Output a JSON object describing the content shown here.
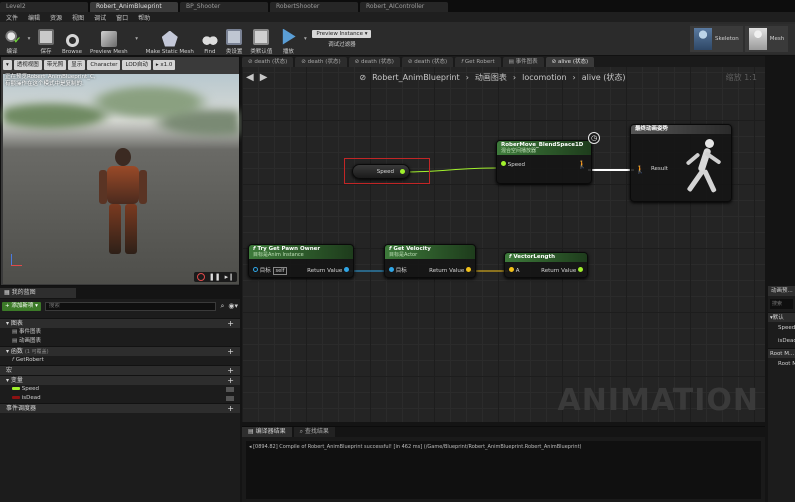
{
  "doc_tabs": [
    "Level2",
    "Robert_AnimBlueprint",
    "BP_Shooter",
    "RobertShooter",
    "Robert_AIController"
  ],
  "menu": [
    "文件",
    "编辑",
    "资源",
    "视图",
    "调试",
    "窗口",
    "帮助"
  ],
  "toolbar": {
    "compile": "编译",
    "save": "保存",
    "browse": "Browse",
    "preview_mesh": "Preview Mesh",
    "make_static_mesh": "Make Static Mesh",
    "find": "Find",
    "class_settings": "类设置",
    "class_defaults": "类默认值",
    "play": "播放",
    "preview_instance": "Preview Instance ▾",
    "debug_filter": "调试过滤器"
  },
  "asset_modes": {
    "skeleton": "Skeleton",
    "mesh": "Mesh"
  },
  "viewport": {
    "buttons": [
      "▾",
      "透视视图",
      "带光照",
      "显示",
      "Character",
      "LOD自动",
      "▸ x1.0"
    ],
    "info_line1": "正在预览Robert_AnimBlueprint_C,",
    "info_line2": "有额操作在这个模式中是复制的."
  },
  "my_blueprint": {
    "tab": "我的蓝图",
    "add_new": "+ 添加新项 ▾",
    "search_placeholder": "搜索",
    "sections": {
      "graphs": "图表",
      "event_graph": "事件图表",
      "anim_graph": "动画图表",
      "functions": "函数",
      "functions_count": "(1 可覆盖)",
      "get_robert": "GetRobert",
      "macros": "宏",
      "variables": "变量",
      "speed": "Speed",
      "is_dead": "isDead",
      "dispatchers": "事件调度器"
    }
  },
  "graph_tabs": [
    "death (状态)",
    "death (状态)",
    "death (状态)",
    "death (状态)",
    "Get Robert",
    "事件图表",
    "alive (状态)"
  ],
  "breadcrumb": {
    "blueprint": "Robert_AnimBlueprint",
    "anim_graph": "动画图表",
    "state_machine": "locomotion",
    "state": "alive (状态)"
  },
  "zoom": "缩放 1:1",
  "nodes": {
    "speed_var": "Speed",
    "blendspace_title": "RoberMove_BlendSpace1D",
    "blendspace_sub": "混合空间播放器",
    "blendspace_pin": "Speed",
    "output_title": "最终动画姿势",
    "output_pin": "Result",
    "pawn_owner_title": "Try Get Pawn Owner",
    "pawn_owner_sub": "目标是Anim Instance",
    "target": "目标",
    "self": "self",
    "return_value": "Return Value",
    "velocity_title": "Get Velocity",
    "velocity_sub": "目标是Actor",
    "vector_length_title": "VectorLength",
    "vector_length_pin": "A"
  },
  "watermark": "ANIMATION",
  "output_panel": {
    "tabs": [
      "编译器结果",
      "查找结果"
    ],
    "log": "[0894.82] Compile of Robert_AnimBlueprint successful! [in 462 ms] (/Game/Blueprint/Robert_AnimBlueprint.Robert_AnimBlueprint)"
  },
  "right_panel": {
    "title": "动画预...",
    "search": "搜索",
    "default": "默认",
    "speed": "Speed",
    "is_dead": "isDead",
    "root_motion": "Root M...",
    "root_motion_val": "Root M..."
  },
  "colors": {
    "accent_green": "#5fb52f",
    "float_pin": "#a1f02c",
    "object_pin": "#2fa6e6",
    "vector_pin": "#f2c11a"
  }
}
